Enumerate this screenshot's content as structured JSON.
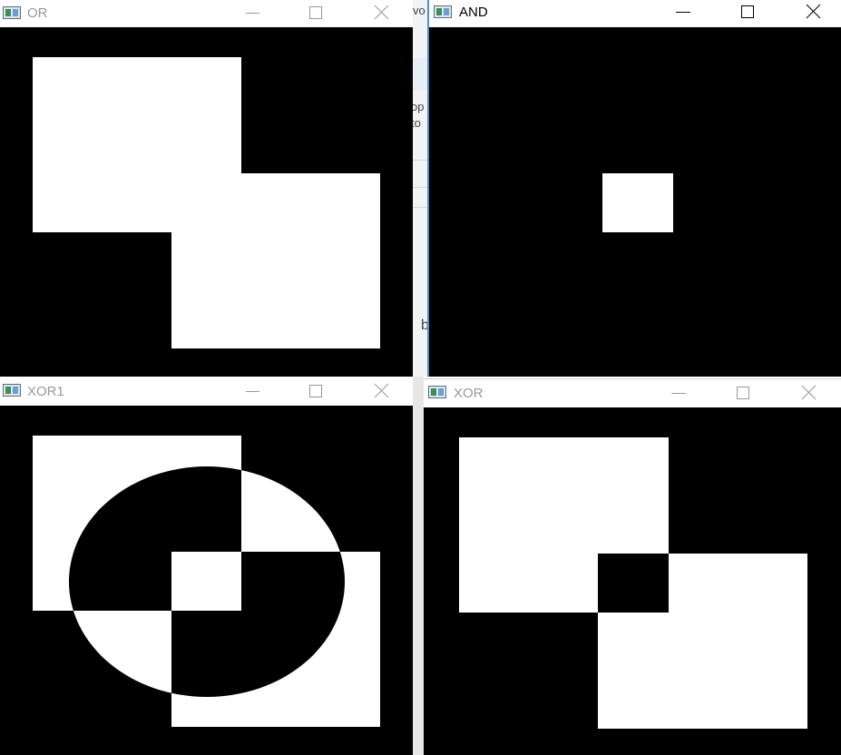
{
  "windows": {
    "or": {
      "title": "OR",
      "active": false
    },
    "and": {
      "title": "AND",
      "active": true
    },
    "xor1": {
      "title": "XOR1",
      "active": false
    },
    "xor": {
      "title": "XOR",
      "active": false
    }
  },
  "background_window": {
    "fragments": [
      "vo",
      "op",
      "to",
      "b"
    ]
  },
  "colors": {
    "titlebar": "#ffffff",
    "canvas": "#000000",
    "shape": "#ffffff",
    "inactive_title": "#999999",
    "active_title": "#000000"
  },
  "icons": {
    "app": "opencv-window-icon",
    "minimize": "minimize-icon",
    "maximize": "maximize-icon",
    "close": "close-icon"
  }
}
